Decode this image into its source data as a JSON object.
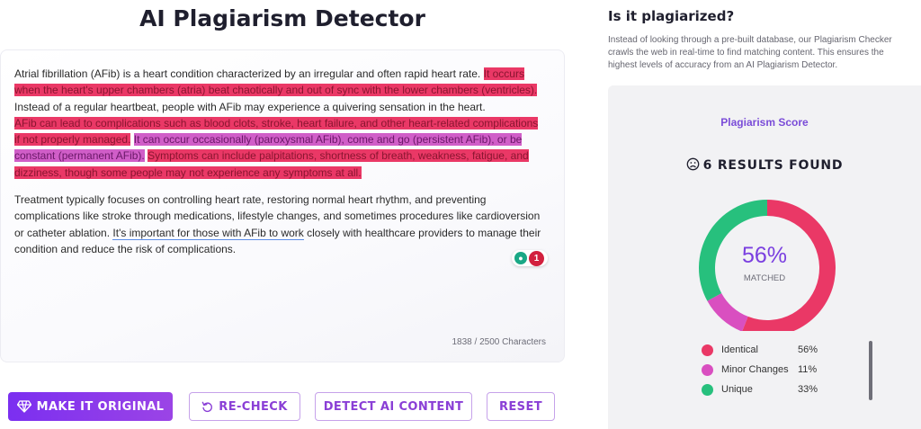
{
  "page": {
    "title": "AI Plagiarism Detector"
  },
  "editor": {
    "p1": [
      {
        "text": "Atrial fibrillation (AFib) is a heart condition characterized by an irregular and often rapid heart rate. ",
        "hl": ""
      },
      {
        "text": "It occurs when the heart's upper chambers (atria) beat chaotically and out of sync with the lower chambers (ventricles).",
        "hl": "red"
      },
      {
        "text": " Instead of a regular heartbeat, people with AFib may experience a quivering sensation in the heart.",
        "hl": ""
      },
      {
        "text": "\n",
        "hl": "br"
      },
      {
        "text": "AFib can lead to complications such as blood clots, stroke, heart failure, and other heart-related complications if not properly managed.",
        "hl": "red"
      },
      {
        "text": " ",
        "hl": ""
      },
      {
        "text": "It can occur occasionally (paroxysmal AFib), come and go (persistent AFib), or be constant (permanent AFib).",
        "hl": "magenta"
      },
      {
        "text": " ",
        "hl": ""
      },
      {
        "text": "Symptoms can include palpitations, shortness of breath, weakness, fatigue, and dizziness, though some people may not experience any symptoms at all.",
        "hl": "red"
      }
    ],
    "p2": [
      {
        "text": "Treatment typically focuses on controlling heart rate, restoring normal heart rhythm, and preventing complications like stroke through medications, lifestyle changes, and sometimes procedures like cardioversion or catheter ablation. ",
        "hl": ""
      },
      {
        "text": "It's important for those with AFib to work",
        "hl": "underline"
      },
      {
        "text": " closely with healthcare providers to manage their condition and reduce the risk of complications.",
        "hl": ""
      }
    ],
    "grammar_count": "1",
    "char_count": "1838 / 2500 Characters"
  },
  "actions": {
    "make_original": "MAKE IT ORIGINAL",
    "recheck": "RE-CHECK",
    "detect_ai": "DETECT AI CONTENT",
    "reset": "RESET"
  },
  "side": {
    "title": "Is it plagiarized?",
    "description": "Instead of looking through a pre-built database, our Plagiarism Checker crawls the web in real-time to find matching content. This ensures the highest levels of accuracy from an AI Plagiarism Detector.",
    "score_label": "Plagiarism Score",
    "results": "6 RESULTS FOUND",
    "matched_pct": "56%",
    "matched_label": "MATCHED"
  },
  "colors": {
    "identical": "#ea3866",
    "minor": "#d94fc0",
    "unique": "#27c07d",
    "accent": "#8a3fd6"
  },
  "chart_data": {
    "type": "pie",
    "categories": [
      "Identical",
      "Minor Changes",
      "Unique"
    ],
    "values": [
      56,
      11,
      33
    ],
    "labels": [
      "56%",
      "11%",
      "33%"
    ]
  }
}
